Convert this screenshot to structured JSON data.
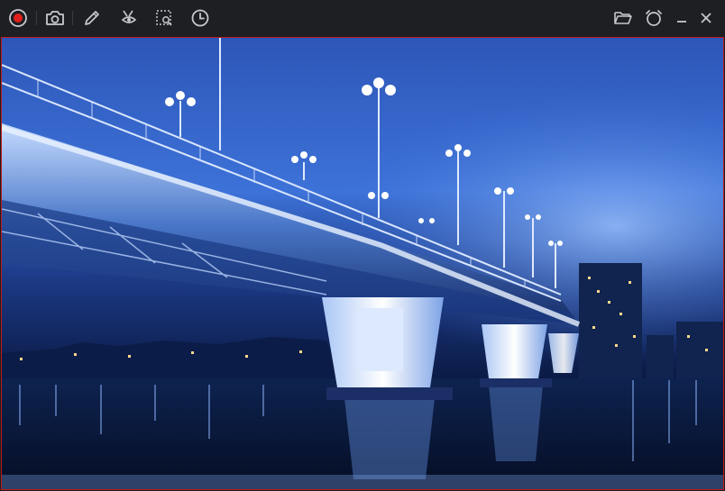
{
  "toolbar": {
    "left_tools": [
      {
        "icon": "record-icon"
      },
      {
        "icon": "camera-icon"
      },
      {
        "icon": "pencil-icon"
      },
      {
        "icon": "eraser-icon"
      },
      {
        "icon": "crop-select-icon"
      },
      {
        "icon": "clock-icon"
      }
    ],
    "right_tools": [
      {
        "icon": "folder-open-icon"
      },
      {
        "icon": "alarm-clock-icon"
      },
      {
        "icon": "minimize-icon"
      },
      {
        "icon": "close-icon"
      }
    ]
  },
  "colors": {
    "record_red": "#e0201c",
    "frame_border": "#c01818",
    "toolbar_bg": "#1e1f22",
    "icon_gray": "#c8c9cc"
  },
  "capture": {
    "subject": "night-bridge-photo"
  }
}
